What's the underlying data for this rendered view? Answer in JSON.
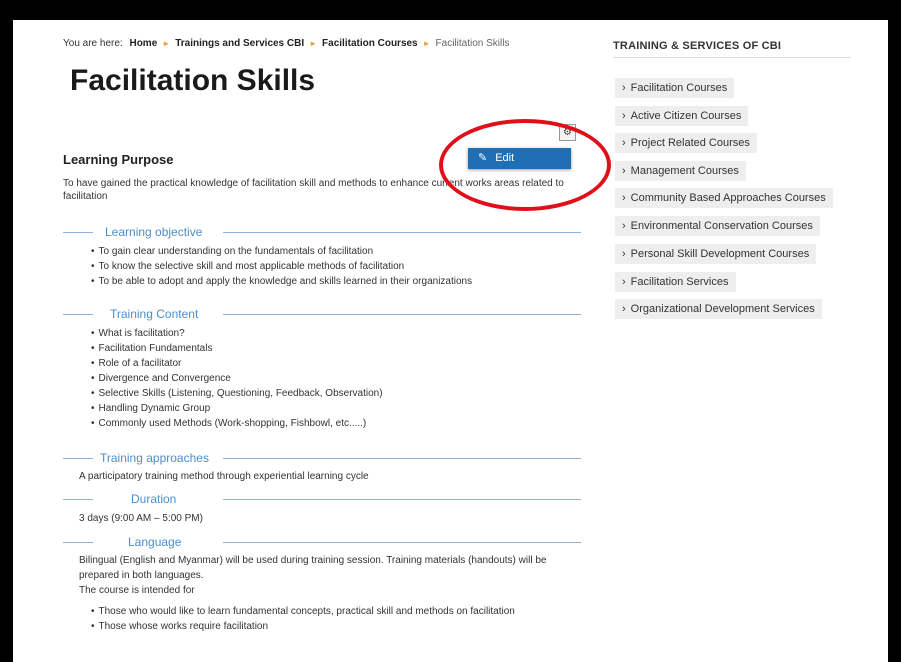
{
  "breadcrumb": {
    "prefix": "You are here:",
    "items": [
      "Home",
      "Trainings and Services CBI",
      "Facilitation Courses",
      "Facilitation Skills"
    ]
  },
  "page_title": "Facilitation Skills",
  "edit_menu": {
    "gear_icon": "gear-icon",
    "edit_label": "Edit",
    "edit_icon": "edit-icon"
  },
  "learning_purpose": {
    "title": "Learning Purpose",
    "text": "To have gained the practical knowledge of facilitation skill and methods to enhance current works areas related to facilitation"
  },
  "learning_objective": {
    "heading": "Learning objective",
    "items": [
      "To gain clear understanding on the fundamentals of facilitation",
      "To know the selective skill and most applicable methods of facilitation",
      "To be able to adopt and apply the knowledge and skills learned in their organizations"
    ]
  },
  "training_content": {
    "heading": "Training Content",
    "items": [
      "What is facilitation?",
      "Facilitation Fundamentals",
      "Role of a facilitator",
      "Divergence and Convergence",
      "Selective Skills (Listening, Questioning, Feedback, Observation)",
      "Handling Dynamic Group",
      "Commonly used Methods (Work-shopping, Fishbowl, etc.....)"
    ]
  },
  "training_approaches": {
    "heading": "Training approaches",
    "text": "A participatory training method through experiential learning cycle"
  },
  "duration": {
    "heading": "Duration",
    "text": "3 days (9:00 AM – 5:00 PM)"
  },
  "language": {
    "heading": "Language",
    "line1": "Bilingual (English and Myanmar) will be used during training session. Training materials (handouts) will be",
    "line2": "prepared in both languages.",
    "line3": "The course is intended for",
    "items": [
      "Those who would like to learn fundamental concepts, practical skill and methods on facilitation",
      "Those whose works require facilitation"
    ]
  },
  "sidebar": {
    "title": "TRAINING & SERVICES OF CBI",
    "items": [
      "Facilitation Courses",
      "Active Citizen Courses",
      "Project Related Courses",
      "Management Courses",
      "Community Based Approaches Courses",
      "Environmental Conservation Courses",
      "Personal Skill Development Courses",
      "Facilitation Services",
      "Organizational Development Services"
    ]
  },
  "colors": {
    "accent": "#4b8fcc",
    "edit_button": "#1f6fb5",
    "annotation": "#e0101a"
  }
}
